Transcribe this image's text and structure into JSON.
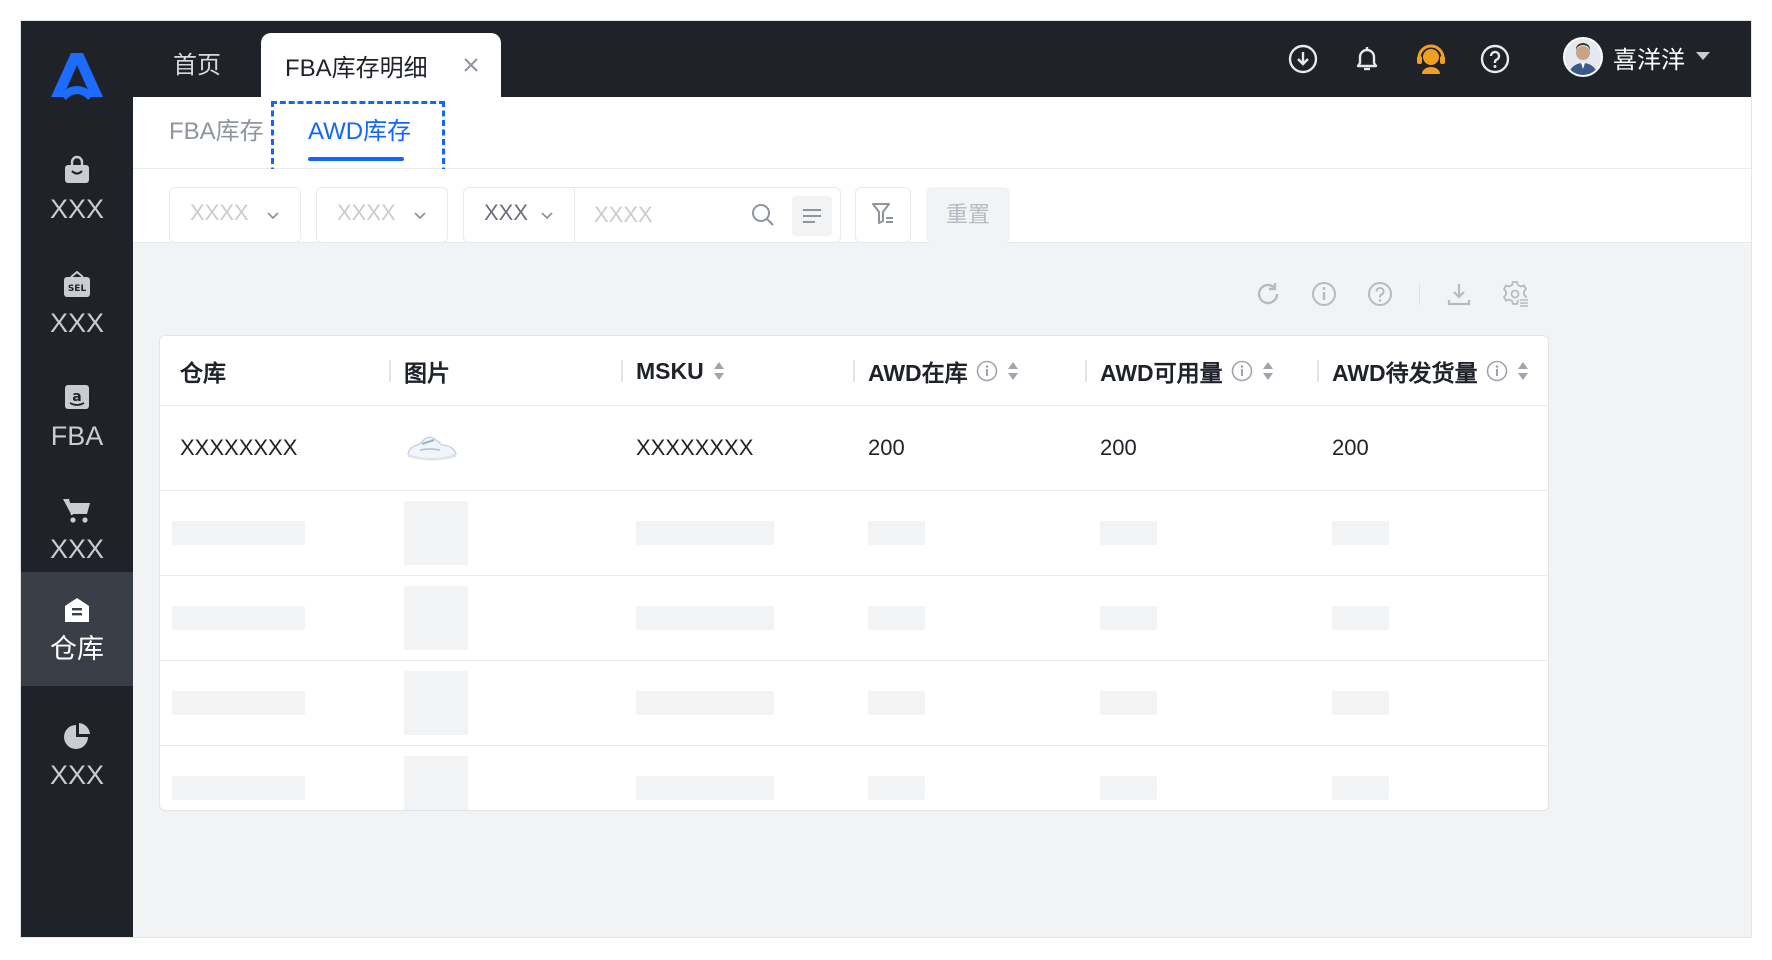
{
  "sidebar": {
    "items": [
      {
        "label": "XXX",
        "icon": "shopping-bag-icon"
      },
      {
        "label": "XXX",
        "icon": "sel-store-icon"
      },
      {
        "label": "FBA",
        "icon": "amazon-icon"
      },
      {
        "label": "XXX",
        "icon": "cart-icon"
      },
      {
        "label": "仓库",
        "icon": "warehouse-icon"
      },
      {
        "label": "XXX",
        "icon": "pie-chart-icon"
      }
    ],
    "active_index": 4
  },
  "topbar": {
    "home_tab": "首页",
    "active_tab": "FBA库存明细",
    "user_name": "喜洋洋"
  },
  "subtabs": {
    "items": [
      "FBA库存",
      "AWD库存"
    ],
    "active": "AWD库存"
  },
  "filters": {
    "select1_placeholder": "XXXX",
    "select2_placeholder": "XXXX",
    "search_type": "XXX",
    "search_placeholder": "XXXX",
    "reset_label": "重置"
  },
  "table": {
    "columns": [
      "仓库",
      "图片",
      "MSKU",
      "AWD在库",
      "AWD可用量",
      "AWD待发货量"
    ],
    "rows": [
      {
        "warehouse": "XXXXXXXX",
        "image": "sneaker-image",
        "msku": "XXXXXXXX",
        "awd_in_stock": "200",
        "awd_available": "200",
        "awd_pending": "200"
      }
    ]
  },
  "colors": {
    "accent": "#1664ff",
    "sidebar_bg": "#1f2329",
    "support_icon": "#f0a020"
  }
}
